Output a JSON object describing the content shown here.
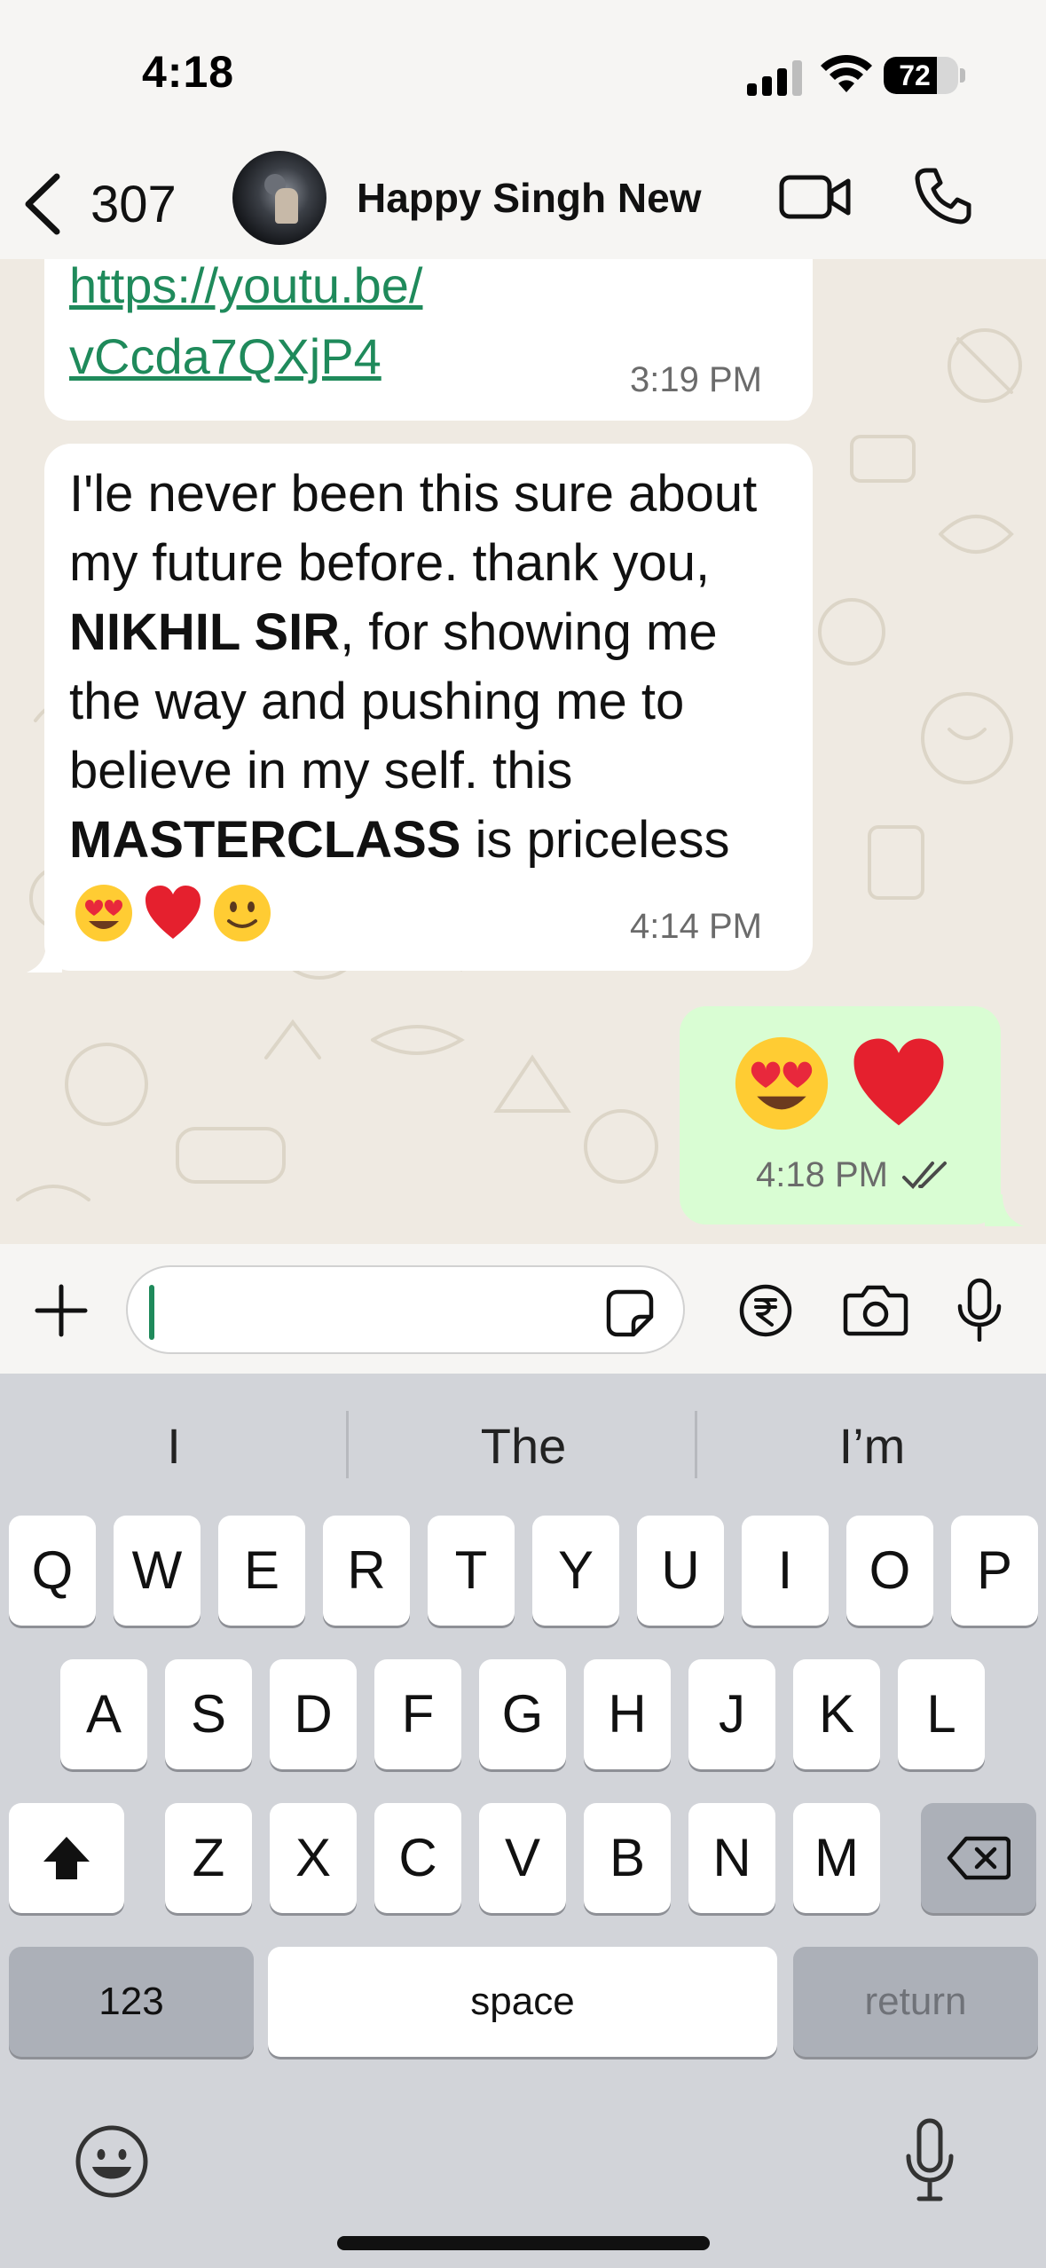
{
  "status_bar": {
    "time": "4:18",
    "battery": "72",
    "battery_level": 0.72
  },
  "header": {
    "back_count": "307",
    "contact_name": "Happy Singh New"
  },
  "messages": [
    {
      "type": "incoming",
      "link_line1": "https://youtu.be/",
      "link_line2": "vCcda7QXjP4",
      "time": "3:19 PM"
    },
    {
      "type": "incoming",
      "text_1": "I'le never been this sure about my future before. thank you, ",
      "bold_1": "NIKHIL SIR",
      "text_2": ", for showing me the way and pushing me to believe in my self. this ",
      "bold_2": "MASTERCLASS",
      "text_3": " is priceless",
      "emojis": [
        "heart-eyes-emoji",
        "red-heart-emoji",
        "slight-smile-emoji"
      ],
      "time": "4:14 PM"
    },
    {
      "type": "outgoing",
      "emojis": [
        "heart-eyes-emoji",
        "red-heart-emoji"
      ],
      "time": "4:18 PM",
      "status": "read"
    }
  ],
  "input": {
    "placeholder": ""
  },
  "keyboard": {
    "suggestions": [
      "I",
      "The",
      "I’m"
    ],
    "row1": [
      "Q",
      "W",
      "E",
      "R",
      "T",
      "Y",
      "U",
      "I",
      "O",
      "P"
    ],
    "row2": [
      "A",
      "S",
      "D",
      "F",
      "G",
      "H",
      "J",
      "K",
      "L"
    ],
    "row3": [
      "Z",
      "X",
      "C",
      "V",
      "B",
      "N",
      "M"
    ],
    "numbers_label": "123",
    "space_label": "space",
    "return_label": "return"
  },
  "colors": {
    "link": "#1f8a5b",
    "outgoing_bubble": "#d9fdd3",
    "incoming_bubble": "#ffffff",
    "read_ticks": "#4a4a4a"
  }
}
